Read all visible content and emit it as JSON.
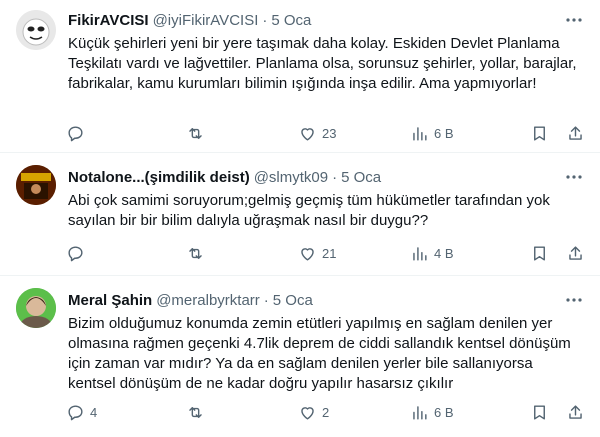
{
  "tweets": [
    {
      "name": "FikirAVCISI",
      "handle": "@iyiFikirAVCISI",
      "separator": "·",
      "time": "5 Oca",
      "text": "Küçük şehirleri yeni bir yere taşımak daha kolay. Eskiden Devlet Planlama Teşkilatı vardı ve lağvettiler. Planlama olsa, sorunsuz şehirler, yollar, barajlar, fabrikalar, kamu kurumları bilimin ışığında inşa edilir. Ama yapmıyorlar!",
      "replies": "",
      "retweets": "",
      "likes": "23",
      "views": "6 B",
      "avatar_color": "#d9d9d9"
    },
    {
      "name": "Notalone...(şimdilik deist)",
      "handle": "@slmytk09",
      "separator": "·",
      "time": "5 Oca",
      "text": "Abi çok samimi soruyorum;gelmiş geçmiş tüm hükümetler tarafından yok sayılan bir bir bilim dalıyla uğraşmak nasıl bir duygu??",
      "replies": "",
      "retweets": "",
      "likes": "21",
      "views": "4 B",
      "avatar_color": "#c8a200"
    },
    {
      "name": "Meral Şahin",
      "handle": "@meralbyrktarr",
      "separator": "·",
      "time": "5 Oca",
      "text": "Bizim olduğumuz konumda zemin etütleri yapılmış en sağlam denilen yer olmasına rağmen geçenki 4.7lik deprem de ciddi sallandık kentsel dönüşüm için zaman var mıdır? Ya da en sağlam denilen yerler bile sallanıyorsa kentsel dönüşüm de ne kadar doğru yapılır hasarsız çıkılır",
      "replies": "4",
      "retweets": "",
      "likes": "2",
      "views": "6 B",
      "avatar_color": "#3aa53a"
    }
  ],
  "more_icon": "more-dots-icon",
  "colors": {
    "text": "#0f1419",
    "secondary": "#536471",
    "border": "#eff3f4"
  }
}
